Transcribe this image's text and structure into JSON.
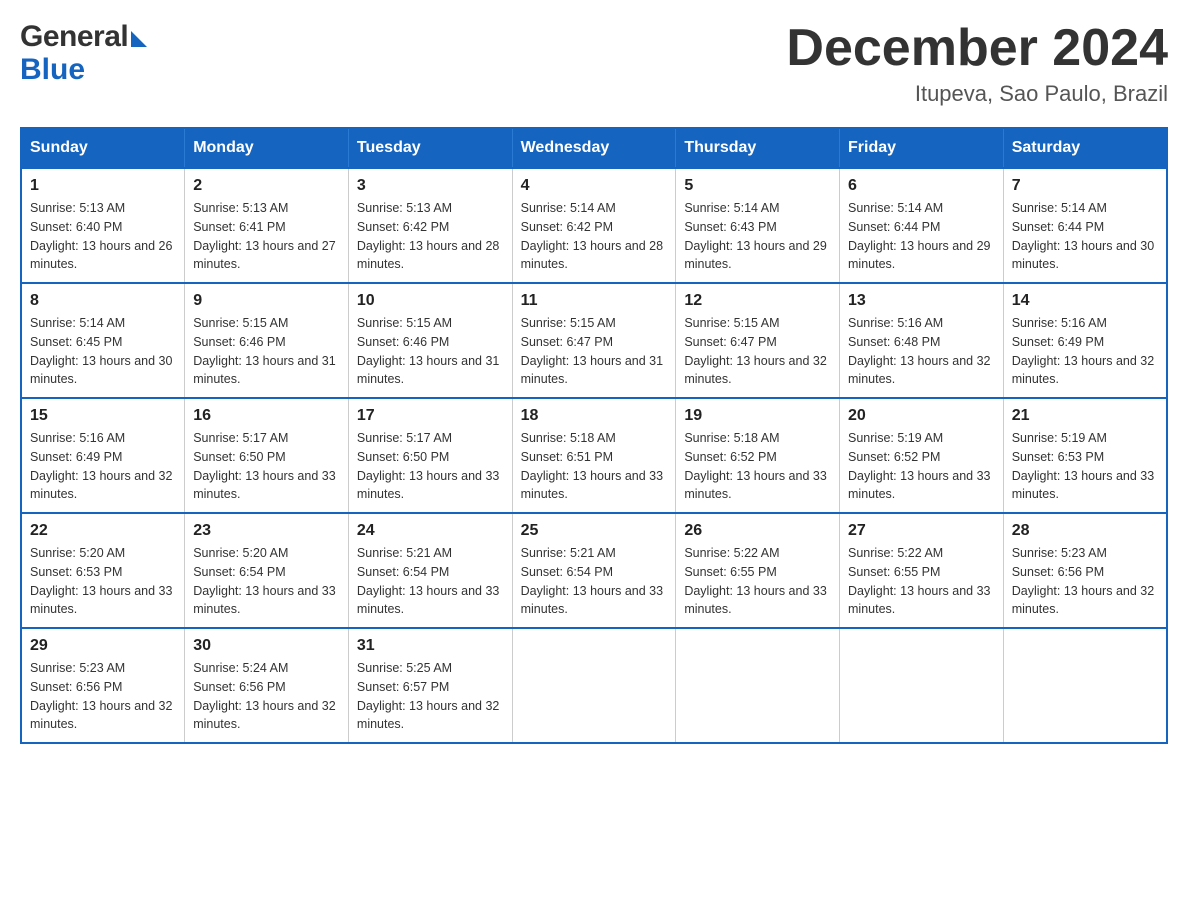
{
  "header": {
    "logo_general": "General",
    "logo_blue": "Blue",
    "month_title": "December 2024",
    "location": "Itupeva, Sao Paulo, Brazil"
  },
  "days_of_week": [
    "Sunday",
    "Monday",
    "Tuesday",
    "Wednesday",
    "Thursday",
    "Friday",
    "Saturday"
  ],
  "weeks": [
    [
      {
        "day": "1",
        "sunrise": "Sunrise: 5:13 AM",
        "sunset": "Sunset: 6:40 PM",
        "daylight": "Daylight: 13 hours and 26 minutes."
      },
      {
        "day": "2",
        "sunrise": "Sunrise: 5:13 AM",
        "sunset": "Sunset: 6:41 PM",
        "daylight": "Daylight: 13 hours and 27 minutes."
      },
      {
        "day": "3",
        "sunrise": "Sunrise: 5:13 AM",
        "sunset": "Sunset: 6:42 PM",
        "daylight": "Daylight: 13 hours and 28 minutes."
      },
      {
        "day": "4",
        "sunrise": "Sunrise: 5:14 AM",
        "sunset": "Sunset: 6:42 PM",
        "daylight": "Daylight: 13 hours and 28 minutes."
      },
      {
        "day": "5",
        "sunrise": "Sunrise: 5:14 AM",
        "sunset": "Sunset: 6:43 PM",
        "daylight": "Daylight: 13 hours and 29 minutes."
      },
      {
        "day": "6",
        "sunrise": "Sunrise: 5:14 AM",
        "sunset": "Sunset: 6:44 PM",
        "daylight": "Daylight: 13 hours and 29 minutes."
      },
      {
        "day": "7",
        "sunrise": "Sunrise: 5:14 AM",
        "sunset": "Sunset: 6:44 PM",
        "daylight": "Daylight: 13 hours and 30 minutes."
      }
    ],
    [
      {
        "day": "8",
        "sunrise": "Sunrise: 5:14 AM",
        "sunset": "Sunset: 6:45 PM",
        "daylight": "Daylight: 13 hours and 30 minutes."
      },
      {
        "day": "9",
        "sunrise": "Sunrise: 5:15 AM",
        "sunset": "Sunset: 6:46 PM",
        "daylight": "Daylight: 13 hours and 31 minutes."
      },
      {
        "day": "10",
        "sunrise": "Sunrise: 5:15 AM",
        "sunset": "Sunset: 6:46 PM",
        "daylight": "Daylight: 13 hours and 31 minutes."
      },
      {
        "day": "11",
        "sunrise": "Sunrise: 5:15 AM",
        "sunset": "Sunset: 6:47 PM",
        "daylight": "Daylight: 13 hours and 31 minutes."
      },
      {
        "day": "12",
        "sunrise": "Sunrise: 5:15 AM",
        "sunset": "Sunset: 6:47 PM",
        "daylight": "Daylight: 13 hours and 32 minutes."
      },
      {
        "day": "13",
        "sunrise": "Sunrise: 5:16 AM",
        "sunset": "Sunset: 6:48 PM",
        "daylight": "Daylight: 13 hours and 32 minutes."
      },
      {
        "day": "14",
        "sunrise": "Sunrise: 5:16 AM",
        "sunset": "Sunset: 6:49 PM",
        "daylight": "Daylight: 13 hours and 32 minutes."
      }
    ],
    [
      {
        "day": "15",
        "sunrise": "Sunrise: 5:16 AM",
        "sunset": "Sunset: 6:49 PM",
        "daylight": "Daylight: 13 hours and 32 minutes."
      },
      {
        "day": "16",
        "sunrise": "Sunrise: 5:17 AM",
        "sunset": "Sunset: 6:50 PM",
        "daylight": "Daylight: 13 hours and 33 minutes."
      },
      {
        "day": "17",
        "sunrise": "Sunrise: 5:17 AM",
        "sunset": "Sunset: 6:50 PM",
        "daylight": "Daylight: 13 hours and 33 minutes."
      },
      {
        "day": "18",
        "sunrise": "Sunrise: 5:18 AM",
        "sunset": "Sunset: 6:51 PM",
        "daylight": "Daylight: 13 hours and 33 minutes."
      },
      {
        "day": "19",
        "sunrise": "Sunrise: 5:18 AM",
        "sunset": "Sunset: 6:52 PM",
        "daylight": "Daylight: 13 hours and 33 minutes."
      },
      {
        "day": "20",
        "sunrise": "Sunrise: 5:19 AM",
        "sunset": "Sunset: 6:52 PM",
        "daylight": "Daylight: 13 hours and 33 minutes."
      },
      {
        "day": "21",
        "sunrise": "Sunrise: 5:19 AM",
        "sunset": "Sunset: 6:53 PM",
        "daylight": "Daylight: 13 hours and 33 minutes."
      }
    ],
    [
      {
        "day": "22",
        "sunrise": "Sunrise: 5:20 AM",
        "sunset": "Sunset: 6:53 PM",
        "daylight": "Daylight: 13 hours and 33 minutes."
      },
      {
        "day": "23",
        "sunrise": "Sunrise: 5:20 AM",
        "sunset": "Sunset: 6:54 PM",
        "daylight": "Daylight: 13 hours and 33 minutes."
      },
      {
        "day": "24",
        "sunrise": "Sunrise: 5:21 AM",
        "sunset": "Sunset: 6:54 PM",
        "daylight": "Daylight: 13 hours and 33 minutes."
      },
      {
        "day": "25",
        "sunrise": "Sunrise: 5:21 AM",
        "sunset": "Sunset: 6:54 PM",
        "daylight": "Daylight: 13 hours and 33 minutes."
      },
      {
        "day": "26",
        "sunrise": "Sunrise: 5:22 AM",
        "sunset": "Sunset: 6:55 PM",
        "daylight": "Daylight: 13 hours and 33 minutes."
      },
      {
        "day": "27",
        "sunrise": "Sunrise: 5:22 AM",
        "sunset": "Sunset: 6:55 PM",
        "daylight": "Daylight: 13 hours and 33 minutes."
      },
      {
        "day": "28",
        "sunrise": "Sunrise: 5:23 AM",
        "sunset": "Sunset: 6:56 PM",
        "daylight": "Daylight: 13 hours and 32 minutes."
      }
    ],
    [
      {
        "day": "29",
        "sunrise": "Sunrise: 5:23 AM",
        "sunset": "Sunset: 6:56 PM",
        "daylight": "Daylight: 13 hours and 32 minutes."
      },
      {
        "day": "30",
        "sunrise": "Sunrise: 5:24 AM",
        "sunset": "Sunset: 6:56 PM",
        "daylight": "Daylight: 13 hours and 32 minutes."
      },
      {
        "day": "31",
        "sunrise": "Sunrise: 5:25 AM",
        "sunset": "Sunset: 6:57 PM",
        "daylight": "Daylight: 13 hours and 32 minutes."
      },
      null,
      null,
      null,
      null
    ]
  ]
}
